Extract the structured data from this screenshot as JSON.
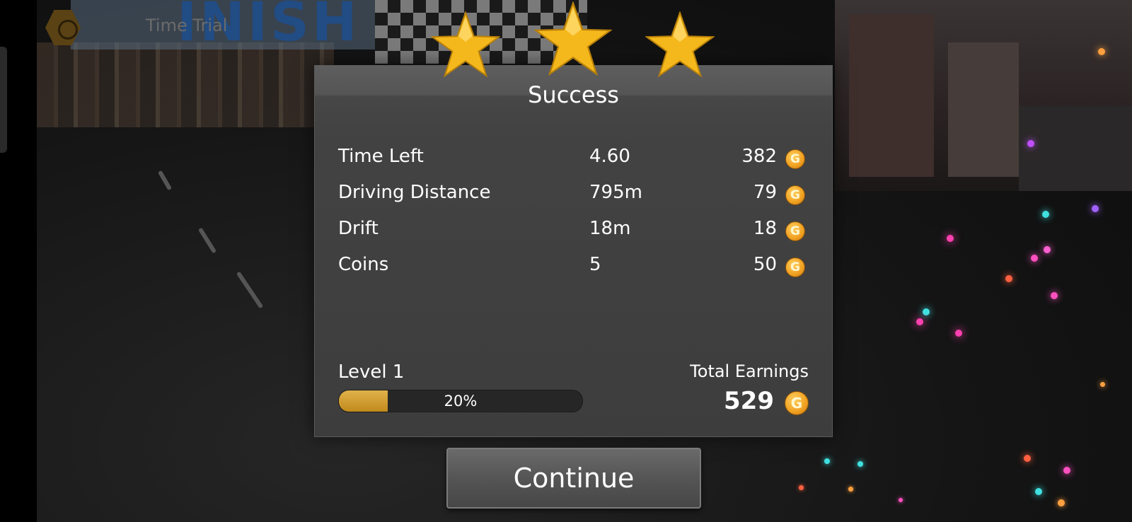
{
  "hud": {
    "mode_label": "Time Trial",
    "badge_icon": "hexagon-badge-icon"
  },
  "banner": {
    "text": "INISH"
  },
  "results": {
    "title": "Success",
    "stars_earned": 3,
    "stars_total": 3,
    "rows": [
      {
        "label": "Time Left",
        "value": "4.60",
        "reward": "382"
      },
      {
        "label": "Driving Distance",
        "value": "795m",
        "reward": "79"
      },
      {
        "label": "Drift",
        "value": "18m",
        "reward": "18"
      },
      {
        "label": "Coins",
        "value": "5",
        "reward": "50"
      }
    ],
    "coin_glyph": "G",
    "level": {
      "label": "Level 1",
      "progress_text": "20%",
      "progress_fraction": 0.2
    },
    "total": {
      "label": "Total Earnings",
      "value": "529"
    }
  },
  "continue_button": {
    "label": "Continue"
  },
  "colors": {
    "star": "#f5b81c",
    "coin": "#f0a020",
    "progress_fill": "#c08a1c",
    "panel_bg": "#404040"
  }
}
